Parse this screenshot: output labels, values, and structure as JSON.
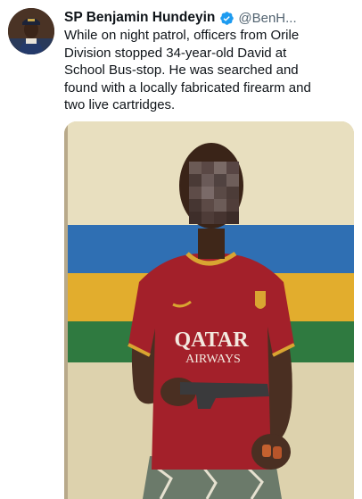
{
  "tweet": {
    "author_name": "SP Benjamin Hundeyin",
    "author_handle": "@BenH...",
    "verified_icon": "verified-badge-icon",
    "text": "While on night patrol, officers from Orile\nDivision stopped 34-year-old David at\nSchool Bus-stop. He was searched and\nfound with a locally fabricated firearm and\ntwo live cartridges.",
    "media": {
      "jersey_text_line1": "QATAR",
      "jersey_text_line2": "AIRWAYS",
      "blurred_region": "face"
    }
  },
  "colors": {
    "verified": "#1d9bf0",
    "text": "#0f1419",
    "secondary_text": "#536471",
    "wall_stripe_blue": "#2f6fb3",
    "wall_stripe_yellow": "#e2ad2d",
    "wall_stripe_green": "#2f7a40",
    "jersey_red": "#a3202a"
  }
}
